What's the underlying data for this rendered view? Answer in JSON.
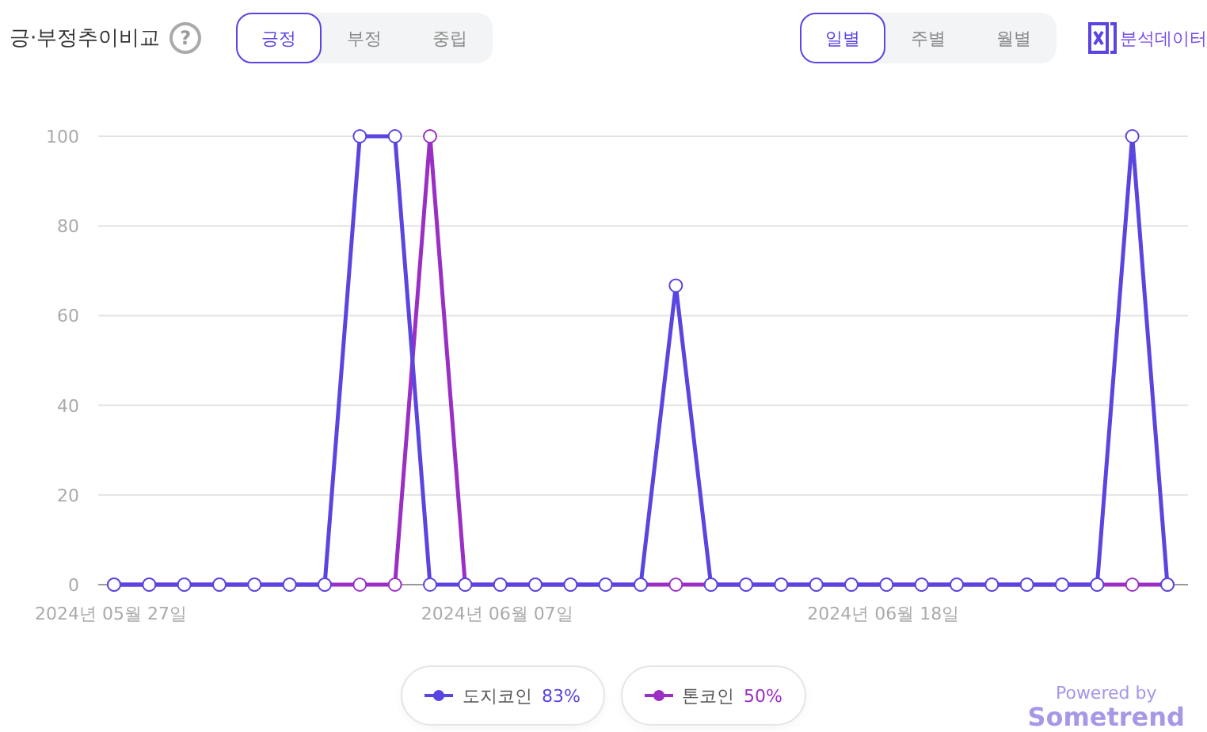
{
  "header": {
    "title": "긍·부정추이비교",
    "help_icon": "?",
    "sentiment_tabs": [
      {
        "label": "긍정",
        "selected": true
      },
      {
        "label": "부정",
        "selected": false
      },
      {
        "label": "중립",
        "selected": false
      }
    ],
    "period_tabs": [
      {
        "label": "일별",
        "selected": true
      },
      {
        "label": "주별",
        "selected": false
      },
      {
        "label": "월별",
        "selected": false
      }
    ],
    "export_label": "분석데이터"
  },
  "chart_data": {
    "type": "line",
    "categories": [
      "2024년 05월 27일",
      null,
      null,
      null,
      null,
      null,
      null,
      null,
      null,
      null,
      null,
      "2024년 06월 07일",
      null,
      null,
      null,
      null,
      null,
      null,
      null,
      null,
      null,
      null,
      "2024년 06월 18일",
      null,
      null,
      null,
      null,
      null,
      null,
      null,
      null
    ],
    "ylim": [
      0,
      100
    ],
    "grid": true,
    "yticks": [
      0,
      20,
      40,
      60,
      80,
      100
    ],
    "series": [
      {
        "name": "도지코인",
        "color": "#5a45e0",
        "marker": "circle",
        "values": [
          0,
          0,
          0,
          0,
          0,
          0,
          0,
          100,
          100,
          0,
          0,
          0,
          0,
          0,
          0,
          0,
          66.7,
          0,
          0,
          0,
          0,
          0,
          0,
          0,
          0,
          0,
          0,
          0,
          0,
          100,
          0
        ]
      },
      {
        "name": "톤코인",
        "color": "#9b2fc4",
        "marker": "circle",
        "values": [
          0,
          0,
          0,
          0,
          0,
          0,
          0,
          0,
          0,
          100,
          0,
          0,
          0,
          0,
          0,
          0,
          0,
          0,
          0,
          0,
          0,
          0,
          0,
          0,
          0,
          0,
          0,
          0,
          0,
          0,
          0
        ]
      }
    ]
  },
  "legend": [
    {
      "share": "83%"
    },
    {
      "share": "50%"
    }
  ],
  "footer": {
    "powered_by": "Powered by",
    "brand": "Sometrend"
  }
}
